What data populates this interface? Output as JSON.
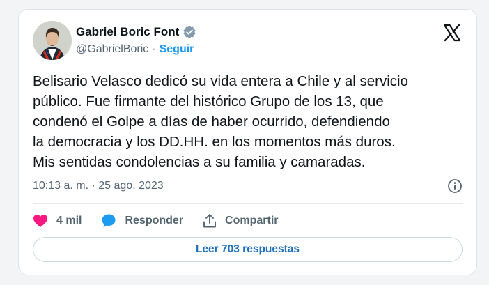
{
  "author": {
    "name": "Gabriel Boric Font",
    "handle": "@GabrielBoric",
    "separator": "·",
    "follow_label": "Seguir"
  },
  "tweet": {
    "text": "Belisario Velasco dedicó su vida entera a Chile y al servicio\npúblico. Fue firmante del histórico Grupo de los 13, que\ncondenó el Golpe a días de haber ocurrido, defendiendo\nla democracia y los DD.HH. en los momentos más duros.\nMis sentidas condolencias a su familia y camaradas.",
    "time": "10:13 a. m.",
    "separator": "·",
    "date": "25 ago. 2023"
  },
  "actions": {
    "likes": "4 mil",
    "reply_label": "Responder",
    "share_label": "Compartir"
  },
  "replies_button": "Leer 703 respuestas",
  "colors": {
    "accent": "#1d9bf0",
    "like": "#f91880",
    "text_secondary": "#536471"
  }
}
